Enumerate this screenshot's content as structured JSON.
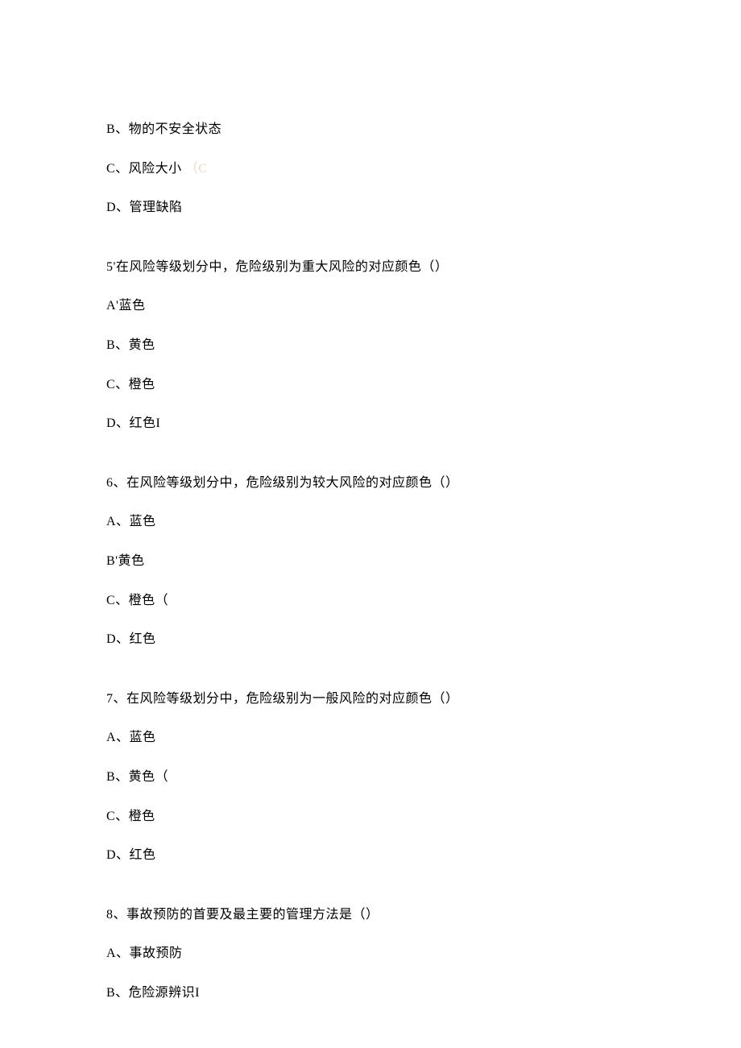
{
  "lines": [
    {
      "text": "B、物的不安全状态",
      "faded": ""
    },
    {
      "text": "C、风险大小",
      "faded": "（C"
    },
    {
      "text": "D、管理缺陷",
      "faded": ""
    }
  ],
  "blocks": [
    {
      "question": "5'在风险等级划分中，危险级别为重大风险的对应颜色（）",
      "options": [
        {
          "text": "A'蓝色",
          "faded": ""
        },
        {
          "text": "B、黄色",
          "faded": ""
        },
        {
          "text": "C、橙色",
          "faded": ""
        },
        {
          "text": "D、红色I",
          "faded": ""
        }
      ]
    },
    {
      "question": "6、在风险等级划分中，危险级别为较大风险的对应颜色（）",
      "options": [
        {
          "text": "A、蓝色",
          "faded": ""
        },
        {
          "text": "B'黄色",
          "faded": ""
        },
        {
          "text": "C、橙色（",
          "faded": ""
        },
        {
          "text": "D、红色",
          "faded": ""
        }
      ]
    },
    {
      "question": "7、在风险等级划分中，危险级别为一般风险的对应颜色（）",
      "options": [
        {
          "text": "A、蓝色",
          "faded": ""
        },
        {
          "text": "B、黄色（",
          "faded": ""
        },
        {
          "text": "C、橙色",
          "faded": ""
        },
        {
          "text": "D、红色",
          "faded": ""
        }
      ]
    },
    {
      "question": "8、事故预防的首要及最主要的管理方法是（）",
      "options": [
        {
          "text": "A、事故预防",
          "faded": ""
        },
        {
          "text": "B、危险源辨识I",
          "faded": ""
        }
      ]
    }
  ]
}
